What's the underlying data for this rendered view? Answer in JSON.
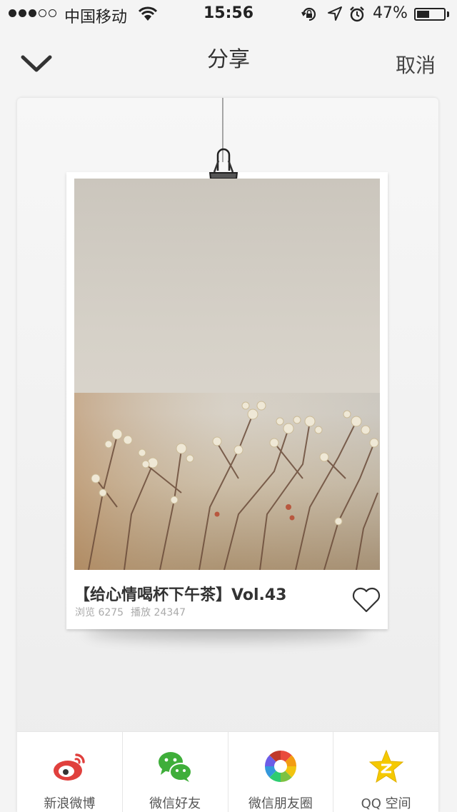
{
  "status_bar": {
    "carrier": "中国移动",
    "time": "15:56",
    "battery": "47%",
    "battery_level": 0.47
  },
  "nav": {
    "title": "分享",
    "cancel": "取消"
  },
  "album": {
    "title": "【给心情喝杯下午茶】Vol.43",
    "views_label": "浏览 6275",
    "plays_label": "播放 24347"
  },
  "share": {
    "items": [
      {
        "label": "新浪微博",
        "icon": "weibo-icon"
      },
      {
        "label": "微信好友",
        "icon": "wechat-icon"
      },
      {
        "label": "微信朋友圈",
        "icon": "moments-icon"
      },
      {
        "label": "QQ 空间",
        "icon": "qzone-icon"
      }
    ]
  },
  "colors": {
    "weibo": "#e0403d",
    "wechat": "#3fae3a",
    "qzone": "#f5c900"
  }
}
